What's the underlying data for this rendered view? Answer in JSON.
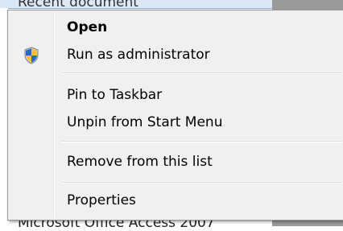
{
  "background": {
    "top_item_text": "Recent document",
    "bottom_item_text": "Microsoft Office Access 2007"
  },
  "menu": {
    "items": [
      {
        "label": "Open",
        "bold": true,
        "icon": null
      },
      {
        "label": "Run as administrator",
        "bold": false,
        "icon": "uac-shield-icon"
      },
      {
        "label": "Pin to Taskbar",
        "bold": false,
        "icon": null
      },
      {
        "label": "Unpin from Start Menu",
        "bold": false,
        "icon": null
      },
      {
        "label": "Remove from this list",
        "bold": false,
        "icon": null
      },
      {
        "label": "Properties",
        "bold": false,
        "icon": null
      }
    ]
  },
  "colors": {
    "menu_bg": "#f0f0f0",
    "menu_border": "#979797",
    "shield_blue": "#2b66c8",
    "shield_yellow": "#f3c233"
  }
}
